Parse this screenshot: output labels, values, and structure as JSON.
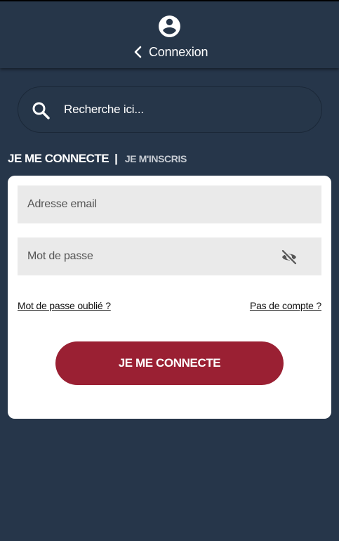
{
  "header": {
    "title": "Connexion",
    "user_icon": "account-circle-icon",
    "back_icon": "chevron-left-icon"
  },
  "search": {
    "placeholder": "Recherche ici...",
    "icon": "search-icon"
  },
  "tabs": {
    "active": "JE ME CONNECTE",
    "separator": "|",
    "inactive": "JE M'INSCRIS"
  },
  "form": {
    "email_placeholder": "Adresse email",
    "password_placeholder": "Mot de passe",
    "eye_icon": "eye-off-icon",
    "forgot_link": "Mot de passe oublié ?",
    "signup_link": "Pas de compte ?",
    "submit_label": "JE ME CONNECTE"
  },
  "colors": {
    "background": "#26364a",
    "accent": "#9a2033",
    "field_bg": "#eaeaea"
  }
}
